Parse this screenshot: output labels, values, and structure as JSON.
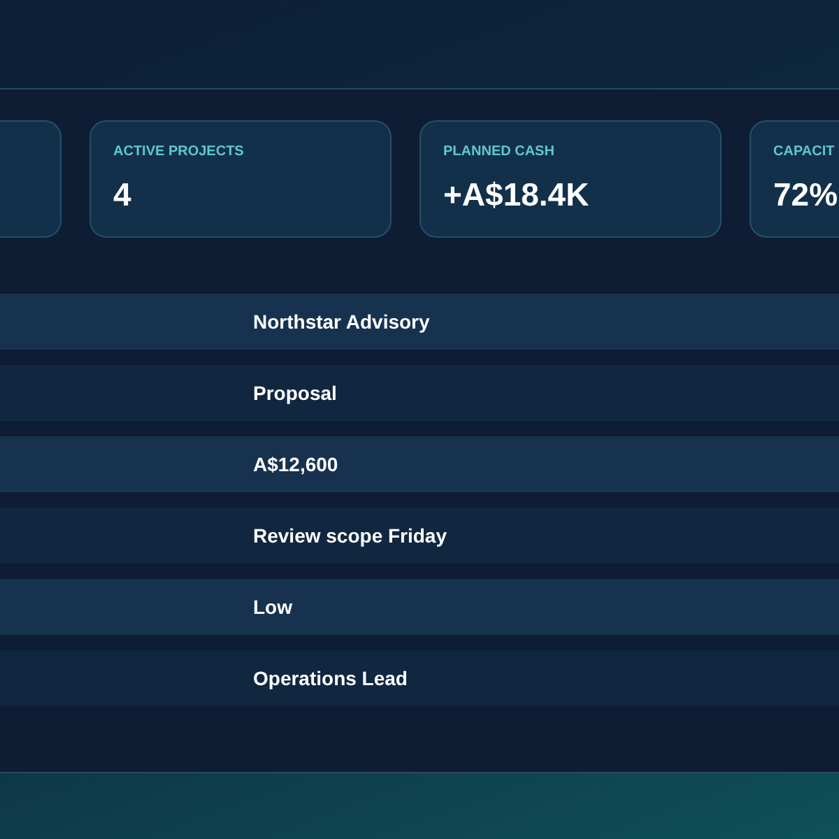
{
  "stats": [
    {
      "label": "ACTIVE PROJECTS",
      "value": "4"
    },
    {
      "label": "PLANNED CASH",
      "value": "+A$18.4K"
    },
    {
      "label": "CAPACIT",
      "value": "72%"
    }
  ],
  "details": [
    {
      "value": "Northstar Advisory"
    },
    {
      "value": "Proposal"
    },
    {
      "value": "A$12,600"
    },
    {
      "value": "Review scope Friday"
    },
    {
      "value": "Low"
    },
    {
      "value": "Operations Lead"
    }
  ]
}
